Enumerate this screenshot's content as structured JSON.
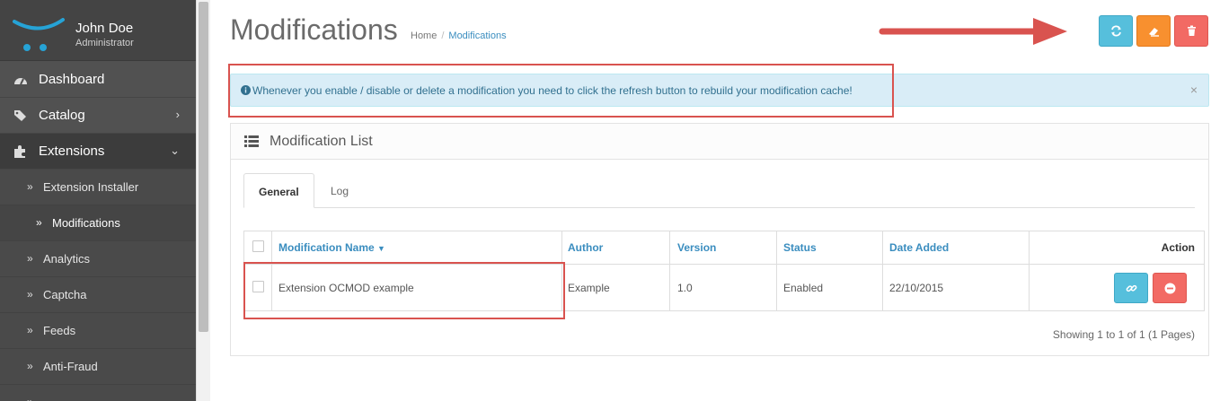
{
  "user": {
    "name": "John Doe",
    "role": "Administrator"
  },
  "sidebar": {
    "items": [
      {
        "label": "Dashboard"
      },
      {
        "label": "Catalog"
      },
      {
        "label": "Extensions"
      }
    ],
    "extensions_children": [
      {
        "label": "Extension Installer"
      },
      {
        "label": "Modifications"
      },
      {
        "label": "Analytics"
      },
      {
        "label": "Captcha"
      },
      {
        "label": "Feeds"
      },
      {
        "label": "Anti-Fraud"
      }
    ]
  },
  "page": {
    "title": "Modifications",
    "breadcrumb": [
      "Home",
      "Modifications"
    ]
  },
  "alert": {
    "text": "Whenever you enable / disable or delete a modification you need to click the refresh button to rebuild your modification cache!",
    "close": "×"
  },
  "panel": {
    "title": "Modification List"
  },
  "tabs": [
    {
      "label": "General"
    },
    {
      "label": "Log"
    }
  ],
  "table": {
    "headers": {
      "name": "Modification Name",
      "author": "Author",
      "version": "Version",
      "status": "Status",
      "date_added": "Date Added",
      "action": "Action"
    },
    "rows": [
      {
        "name": "Extension OCMOD example",
        "author": "Example",
        "version": "1.0",
        "status": "Enabled",
        "date_added": "22/10/2015"
      }
    ]
  },
  "pagination": {
    "info": "Showing 1 to 1 of 1 (1 Pages)"
  },
  "colors": {
    "sidebar_bg": "#515151",
    "info": "#56bfdc",
    "warning": "#f8902f",
    "danger": "#f26a64",
    "link": "#3a8dbf",
    "annotation": "#d9534f"
  }
}
